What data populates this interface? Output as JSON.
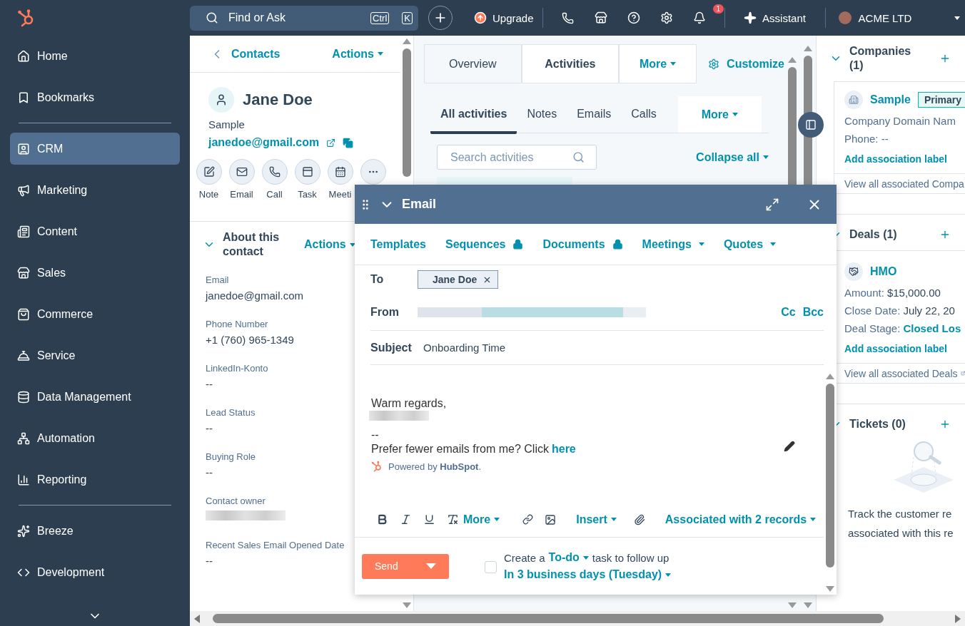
{
  "topbar": {
    "search_placeholder": "Find or Ask",
    "shortcut_keys": [
      "Ctrl",
      "K"
    ],
    "upgrade": "Upgrade",
    "notification_count": "1",
    "assistant": "Assistant",
    "account": "ACME LTD"
  },
  "sidebar": {
    "groups": [
      [
        {
          "label": "Home",
          "selected": false
        },
        {
          "label": "Bookmarks",
          "selected": false
        }
      ],
      [
        {
          "label": "CRM",
          "selected": true
        },
        {
          "label": "Marketing",
          "selected": false
        },
        {
          "label": "Content",
          "selected": false
        },
        {
          "label": "Sales",
          "selected": false
        },
        {
          "label": "Commerce",
          "selected": false
        },
        {
          "label": "Service",
          "selected": false
        },
        {
          "label": "Data Management",
          "selected": false
        },
        {
          "label": "Automation",
          "selected": false
        },
        {
          "label": "Reporting",
          "selected": false
        }
      ],
      [
        {
          "label": "Breeze",
          "selected": false
        },
        {
          "label": "Development",
          "selected": false
        }
      ]
    ]
  },
  "contact": {
    "back": "Contacts",
    "actions": "Actions",
    "name": "Jane Doe",
    "company": "Sample",
    "email": "janedoe@gmail.com",
    "quick_actions": [
      "Note",
      "Email",
      "Call",
      "Task",
      "Meeti"
    ],
    "about": {
      "title": "About this contact",
      "actions": "Actions",
      "expanded": true,
      "properties": [
        {
          "kind": "text",
          "label": "Email",
          "value": "janedoe@gmail.com"
        },
        {
          "kind": "text",
          "label": "Phone Number",
          "value": "+1 (760) 965-1349"
        },
        {
          "kind": "text",
          "label": "LinkedIn-Konto",
          "value": "--"
        },
        {
          "kind": "text",
          "label": "Lead Status",
          "value": "--"
        },
        {
          "kind": "text",
          "label": "Buying Role",
          "value": "--"
        },
        {
          "kind": "redacted",
          "label": "Contact owner"
        },
        {
          "kind": "text",
          "label": "Recent Sales Email Opened Date",
          "value": "--"
        }
      ]
    }
  },
  "record_tabs": [
    {
      "kind": "tab",
      "label": "Overview",
      "selected": false
    },
    {
      "kind": "tab",
      "label": "Activities",
      "selected": true
    },
    {
      "kind": "dropdown",
      "label": "More",
      "selected": false
    }
  ],
  "customize": "Customize",
  "activity_tabs": [
    {
      "kind": "tab",
      "label": "All activities",
      "selected": true
    },
    {
      "kind": "tab",
      "label": "Notes",
      "selected": false
    },
    {
      "kind": "tab",
      "label": "Emails",
      "selected": false
    },
    {
      "kind": "tab",
      "label": "Calls",
      "selected": false
    },
    {
      "kind": "dropdown",
      "label": "More",
      "selected": false
    }
  ],
  "activity_search_placeholder": "Search activities",
  "collapse_all": "Collapse all",
  "composer": {
    "title": "Email",
    "tools": [
      {
        "label": "Templates",
        "locked": false,
        "dropdown": false
      },
      {
        "label": "Sequences",
        "locked": true,
        "dropdown": false
      },
      {
        "label": "Documents",
        "locked": true,
        "dropdown": false
      },
      {
        "label": "Meetings",
        "locked": false,
        "dropdown": true
      },
      {
        "label": "Quotes",
        "locked": false,
        "dropdown": true
      }
    ],
    "to_label": "To",
    "recipient": "Jane Doe",
    "from_label": "From",
    "cc": "Cc",
    "bcc": "Bcc",
    "subject_label": "Subject",
    "subject": "Onboarding Time",
    "closing": "Warm regards,",
    "separator": "--",
    "unsubscribe_text": "Prefer fewer emails from me? Click",
    "unsubscribe_link": "here",
    "powered": "Powered by **HubSpot**.",
    "format_more": "More",
    "insert": "Insert",
    "associated": "Associated with 2 records",
    "send": "Send",
    "follow_up": {
      "checked": false,
      "prefix": "Create a",
      "task_type": "To-do",
      "suffix": "task to follow up",
      "due": "In 3 business days (Tuesday)"
    }
  },
  "sidebar_right": {
    "companies": {
      "title": "Companies (1)",
      "name": "Sample",
      "badge": "Primary",
      "lines": [
        "Company Domain Nam",
        "Phone: --"
      ],
      "label_link": "Add association label",
      "view_all": "View all associated Compa"
    },
    "deals": {
      "title": "Deals (1)",
      "name": "HMO",
      "amount_label": "Amount:",
      "amount": "$15,000.00",
      "close_label": "Close Date:",
      "close": "July 22, 20",
      "stage_label": "Deal Stage:",
      "stage": "Closed Los",
      "label_link": "Add association label",
      "view_all": "View all associated Deals"
    },
    "tickets": {
      "title": "Tickets (0)",
      "empty_lines": [
        "Track the customer re",
        "associated with this re"
      ]
    }
  }
}
